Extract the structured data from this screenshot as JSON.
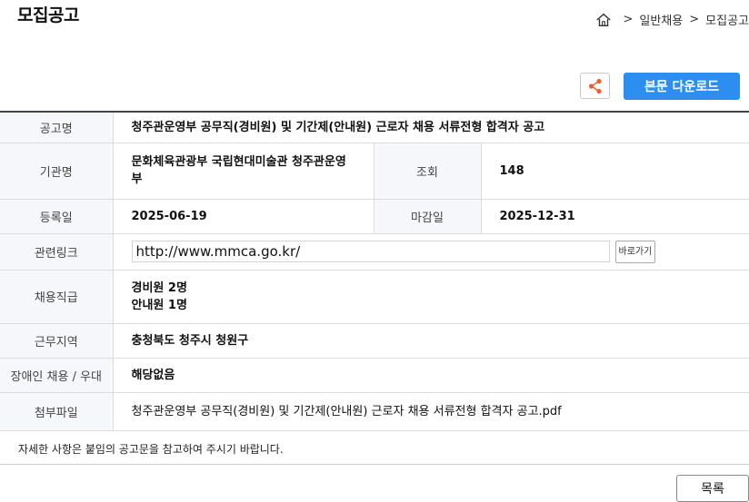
{
  "page": {
    "title": "모집공고"
  },
  "breadcrumb": {
    "home_icon": "home-icon",
    "items": [
      "일반채용",
      "모집공고"
    ],
    "separator": ">"
  },
  "toolbar": {
    "share_icon": "share-icon",
    "download_label": "본문 다운로드"
  },
  "notice": {
    "rows": {
      "title": {
        "label": "공고명",
        "value": "청주관운영부 공무직(경비원) 및 기간제(안내원) 근로자 채용 서류전형 합격자 공고"
      },
      "agency": {
        "label": "기관명",
        "value": "문화체육관광부 국립현대미술관 청주관운영부"
      },
      "views": {
        "label": "조회",
        "value": "148"
      },
      "registered": {
        "label": "등록일",
        "value": "2025-06-19"
      },
      "deadline": {
        "label": "마감일",
        "value": "2025-12-31"
      },
      "link": {
        "label": "관련링크",
        "value": "http://www.mmca.go.kr/",
        "button": "바로가기"
      },
      "positions": {
        "label": "채용직급",
        "values": [
          "경비원 2명",
          "안내원 1명"
        ]
      },
      "location": {
        "label": "근무지역",
        "value": "충청북도 청주시 청원구"
      },
      "disability": {
        "label": "장애인 채용 / 우대",
        "value": "해당없음"
      },
      "attachment": {
        "label": "첨부파일",
        "value": "청주관운영부 공무직(경비원) 및 기간제(안내원) 근로자 채용 서류전형 합격자 공고.pdf"
      }
    },
    "footer_note": "자세한 사항은 붙임의 공고문을 참고하여 주시기 바랍니다."
  },
  "actions": {
    "list_label": "목록"
  },
  "colors": {
    "accent": "#2c8ef0",
    "share_icon": "#e8632b",
    "header_bg": "#f5f7fa"
  }
}
